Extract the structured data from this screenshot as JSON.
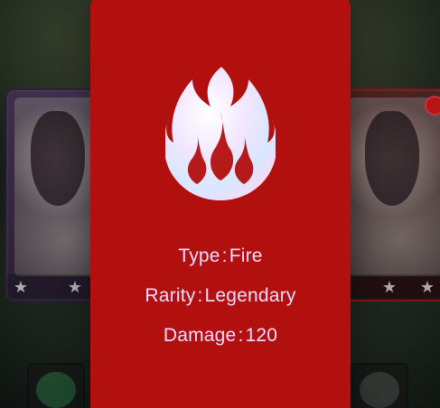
{
  "card_detail": {
    "icon": "fire-icon",
    "colors": {
      "panel": "#b20f0f",
      "text": "#f2dcff"
    },
    "stats": [
      {
        "label": "Type",
        "value": "Fire"
      },
      {
        "label": "Rarity",
        "value": "Legendary"
      },
      {
        "label": "Damage",
        "value": "120"
      }
    ]
  },
  "background_cards": {
    "left": {
      "stars_icon": "star-icon"
    },
    "right": {
      "stars_icon": "star-icon",
      "badge_icon": "fire-badge-icon"
    }
  },
  "separator": ":"
}
